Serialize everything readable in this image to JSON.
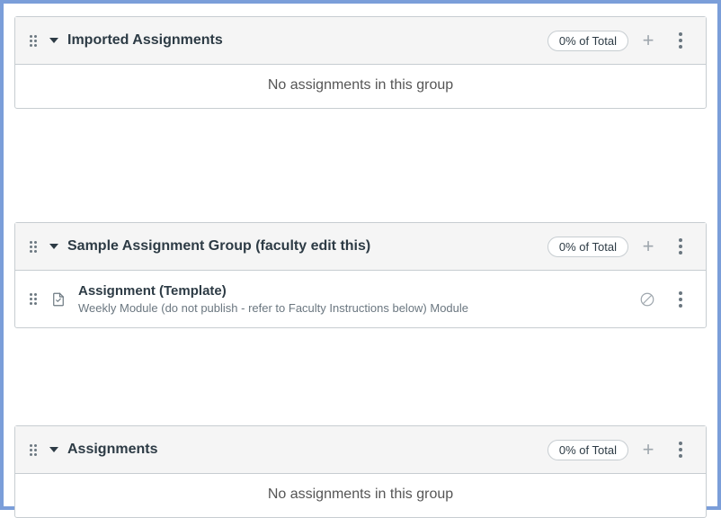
{
  "groups": [
    {
      "title": "Imported Assignments",
      "weight_label": "0% of Total",
      "empty_message": "No assignments in this group",
      "assignments": []
    },
    {
      "title": "Sample Assignment Group (faculty edit this)",
      "weight_label": "0% of Total",
      "empty_message": null,
      "assignments": [
        {
          "title": "Assignment (Template)",
          "subtitle": "Weekly Module (do not publish - refer to Faculty Instructions below) Module",
          "published": false
        }
      ]
    },
    {
      "title": "Assignments",
      "weight_label": "0% of Total",
      "empty_message": "No assignments in this group",
      "assignments": []
    }
  ],
  "group_margins": [
    126,
    108,
    0
  ]
}
